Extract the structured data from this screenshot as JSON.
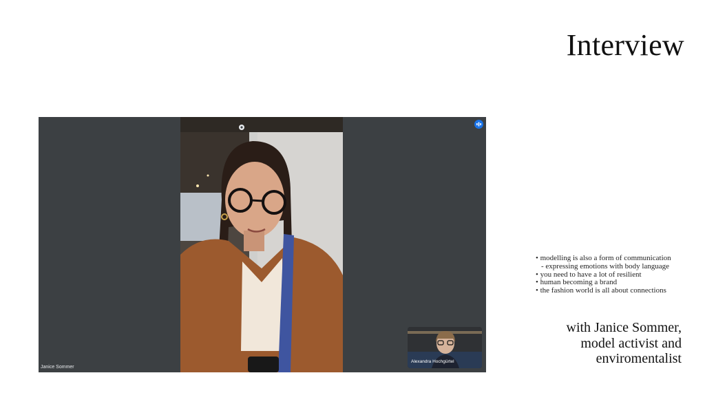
{
  "slide": {
    "title": "Interview",
    "notes": [
      {
        "text": "• modelling is also a form of communication"
      },
      {
        "text": "- expressing emotions with body language"
      },
      {
        "text": "• you need to have a lot of resilient"
      },
      {
        "text": "• human becoming a brand"
      },
      {
        "text": "• the fashion world is all about connections"
      }
    ],
    "subtitle_lines": [
      "with Janice Sommer,",
      "model activist and",
      "enviromentalist"
    ]
  },
  "call": {
    "main_participant": "Janice Sommer",
    "self_participant": "Alexandra Hochgürtel",
    "icons": {
      "pin": "pin-icon",
      "speaking": "audio-indicator-icon"
    },
    "colors": {
      "tile_background": "#3c4043",
      "accent": "#1a73e8"
    }
  }
}
